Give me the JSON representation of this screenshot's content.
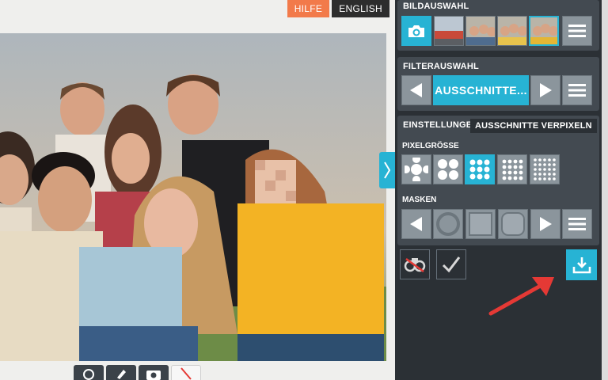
{
  "header": {
    "help_label": "HILFE",
    "language_label": "ENGLISH"
  },
  "panel": {
    "image_selection_title": "BILDAUSWAHL",
    "filter_selection_title": "FILTERAUSWAHL",
    "filter_current": "AUSSCHNITTE...",
    "settings_title": "EINSTELLUNGEN:",
    "settings_mode": "AUSSCHNITTE VERPIXELN",
    "pixel_size_title": "PIXELGRÖSSE",
    "masks_title": "MASKEN"
  },
  "icons": {
    "camera": "camera-icon",
    "menu": "hamburger-icon",
    "prev": "triangle-left-icon",
    "next": "triangle-right-icon",
    "download": "download-icon",
    "eraser": "eraser-icon",
    "check": "checkmark-icon"
  },
  "colors": {
    "accent": "#27b3d4",
    "help": "#f27a4a",
    "panel": "#2b3035",
    "section": "#434a51",
    "arrow": "#e53935"
  },
  "state": {
    "pixel_size_selected_index": 2,
    "image_thumb_selected_index": 3
  }
}
